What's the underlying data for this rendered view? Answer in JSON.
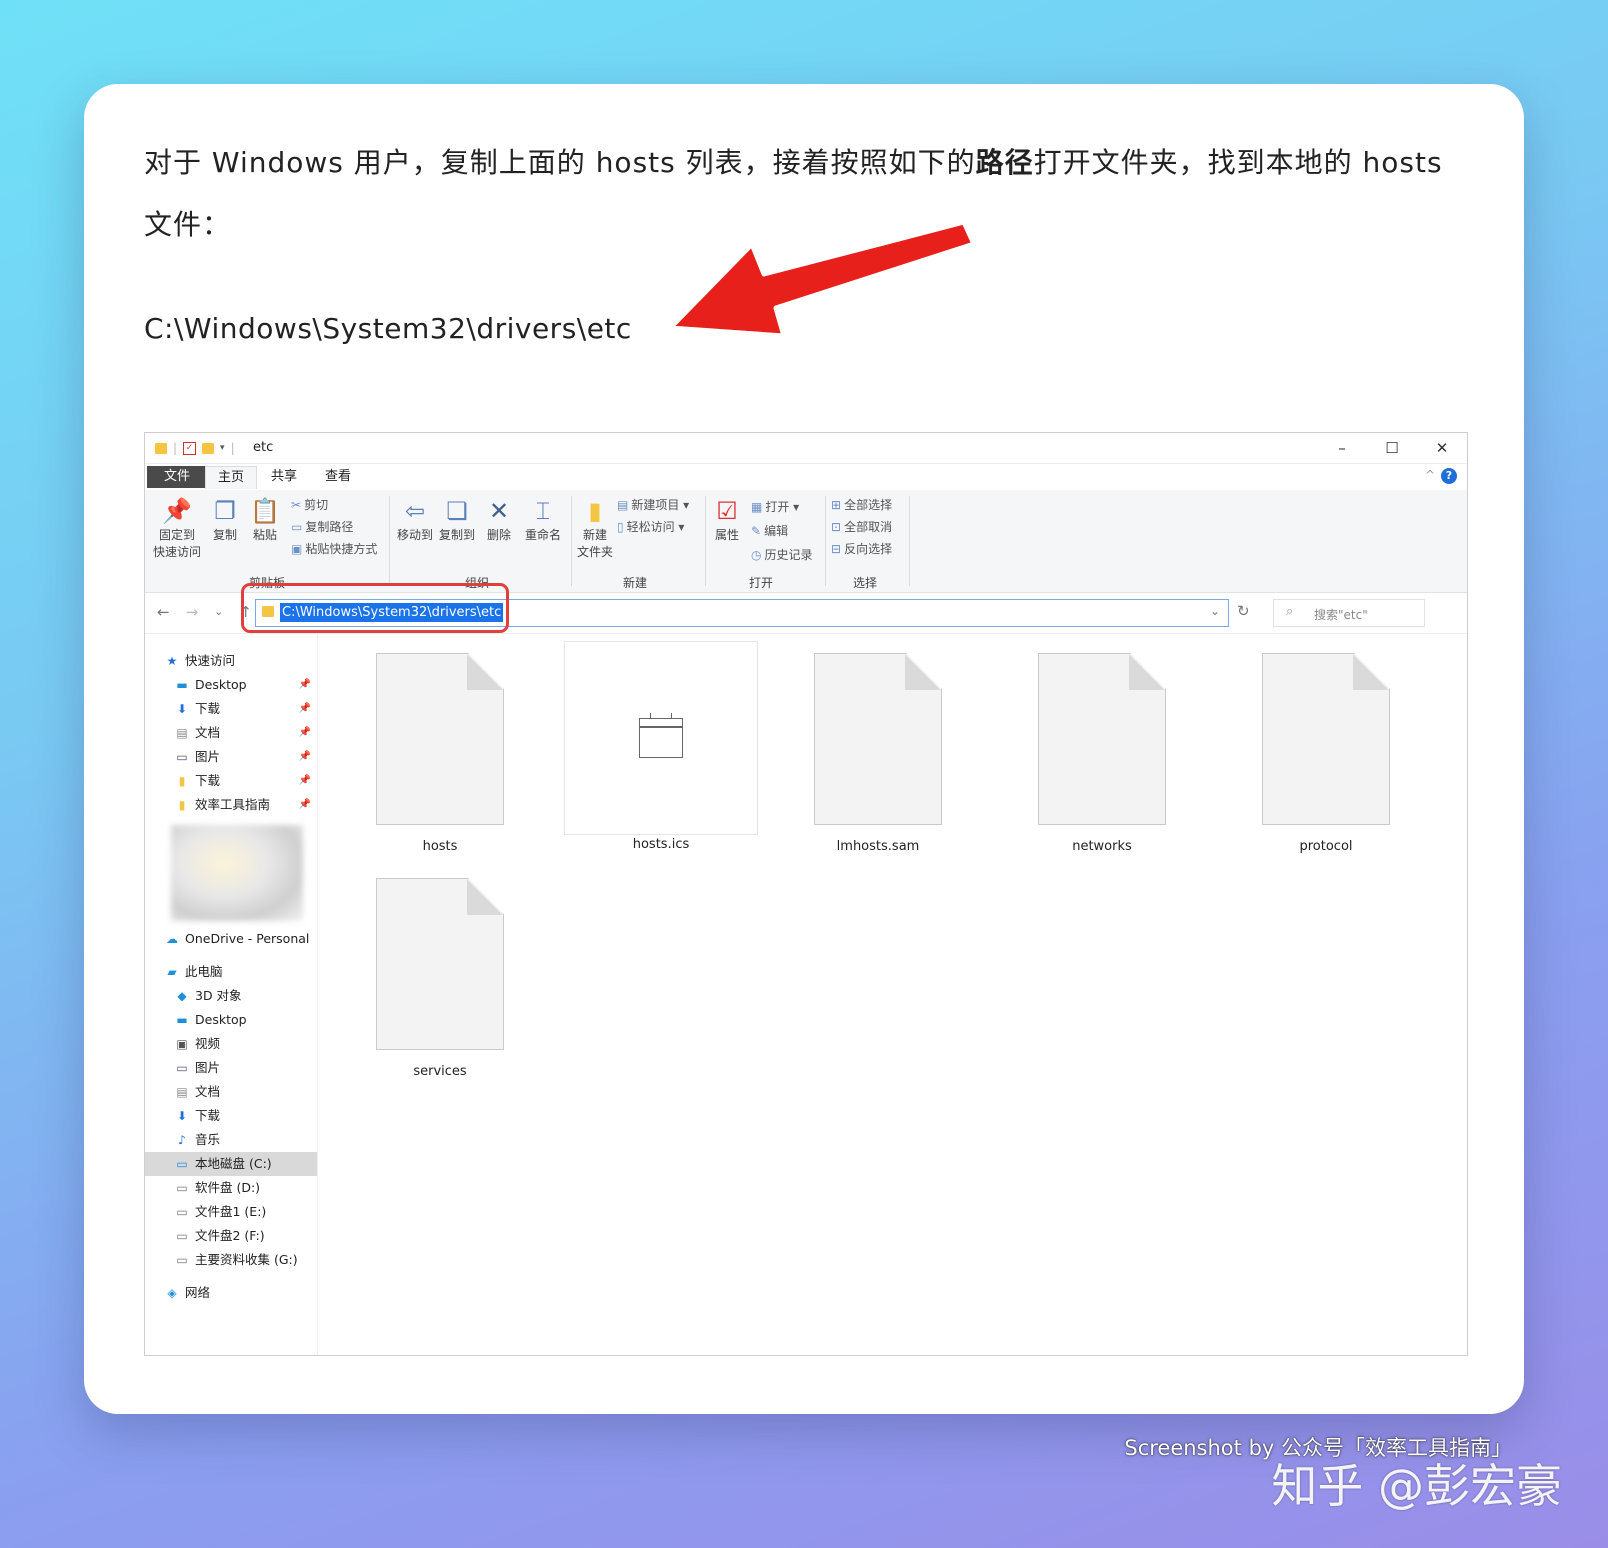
{
  "article": {
    "para_part1": "对于 Windows 用户，复制上面的 hosts 列表，接着按照如下的",
    "para_bold": "路径",
    "para_part2": "打开文件夹，找到本地的 hosts 文件：",
    "path": "C:\\Windows\\System32\\drivers\\etc"
  },
  "window": {
    "title": "etc",
    "controls": {
      "minimize": "–",
      "maximize": "☐",
      "close": "✕"
    },
    "tabs": [
      {
        "label": "文件"
      },
      {
        "label": "主页"
      },
      {
        "label": "共享"
      },
      {
        "label": "查看"
      }
    ],
    "ribbon": {
      "pin_line1": "固定到",
      "pin_line2": "快速访问",
      "copy": "复制",
      "paste": "粘贴",
      "cut": "剪切",
      "copy_path": "复制路径",
      "paste_shortcut": "粘贴快捷方式",
      "group_clipboard": "剪贴板",
      "move_to": "移动到",
      "copy_to": "复制到",
      "delete": "删除",
      "rename": "重命名",
      "group_organize": "组织",
      "new_folder_line1": "新建",
      "new_folder_line2": "文件夹",
      "new_item": "新建项目 ▾",
      "easy_access": "轻松访问 ▾",
      "group_new": "新建",
      "properties": "属性",
      "open": "打开 ▾",
      "edit": "编辑",
      "history": "历史记录",
      "group_open": "打开",
      "select_all": "全部选择",
      "select_none": "全部取消",
      "invert_selection": "反向选择",
      "group_select": "选择"
    },
    "address": "C:\\Windows\\System32\\drivers\\etc",
    "search_placeholder": "搜索\"etc\"",
    "sidebar": {
      "quick_access": "快速访问",
      "qa_items": [
        "Desktop",
        "下载",
        "文档",
        "图片",
        "下载",
        "效率工具指南"
      ],
      "onedrive": "OneDrive - Personal",
      "this_pc": "此电脑",
      "pc_items": [
        "3D 对象",
        "Desktop",
        "视频",
        "图片",
        "文档",
        "下载",
        "音乐",
        "本地磁盘 (C:)",
        "软件盘 (D:)",
        "文件盘1 (E:)",
        "文件盘2 (F:)",
        "主要资料收集 (G:)"
      ],
      "network": "网络"
    },
    "files": [
      "hosts",
      "hosts.ics",
      "lmhosts.sam",
      "networks",
      "protocol",
      "services"
    ]
  },
  "credit": "Screenshot by 公众号「效率工具指南」",
  "watermark": "知乎 @彭宏豪",
  "colors": {
    "arrow": "#e8201c",
    "highlight_box": "#e0403d",
    "selection": "#1a73e8"
  }
}
